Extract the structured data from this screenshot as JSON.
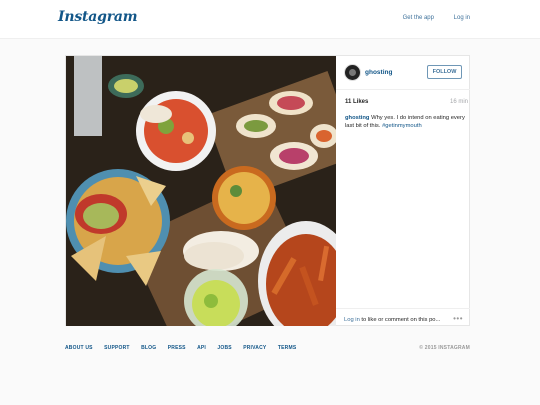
{
  "header": {
    "logo": "Instagram",
    "get_app": "Get the app",
    "login": "Log in"
  },
  "post": {
    "username": "ghosting",
    "follow_label": "FOLLOW",
    "likes": "11 Likes",
    "time": "16 min",
    "caption_user": "ghosting",
    "caption_text": " Why yes. I do intend on eating every last bit of this. ",
    "caption_tag": "#getinmymouth",
    "comment_login": "Log in",
    "comment_rest": " to like or comment on this po...",
    "more": "•••"
  },
  "footer": {
    "links": [
      "ABOUT US",
      "SUPPORT",
      "BLOG",
      "PRESS",
      "API",
      "JOBS",
      "PRIVACY",
      "TERMS"
    ],
    "copyright": "© 2015 INSTAGRAM"
  },
  "colors": {
    "link_blue": "#3f729b",
    "brand_blue": "#125688",
    "background": "#fafafa"
  }
}
